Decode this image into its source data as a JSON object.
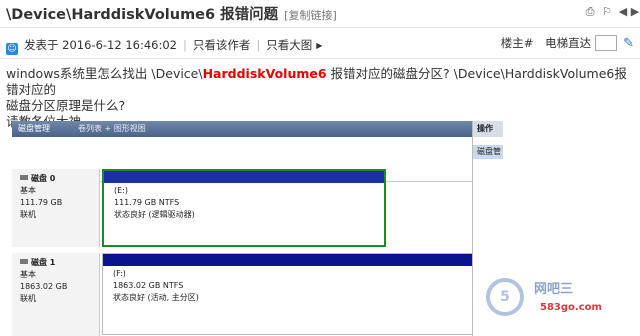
{
  "header": {
    "title": "\\Device\\HarddiskVolume6 报错问题",
    "copy_link": "[复制链接]",
    "icons": [
      "print-icon",
      "favorite-icon",
      "prev-icon",
      "next-icon"
    ]
  },
  "meta": {
    "posted": "发表于 2016-6-12 16:46:02",
    "only_author": "只看该作者",
    "only_big_image": "只看大图",
    "floor": "楼主#",
    "elevator": "电梯直达"
  },
  "post": {
    "line1_a": "windows系统里怎么找出 \\Device\\",
    "line1_red": "HarddiskVolume6",
    "line1_b": " 报错对应的磁盘分区? \\Device\\HarddiskVolume6报错对应的",
    "line2": "磁盘分区原理是什么?",
    "line3": "请教各位大神"
  },
  "screenshot": {
    "header_title": "磁盘管理",
    "header_view": "卷列表 + 图形视图",
    "actions_title": "操作",
    "actions_item": "磁盘管",
    "disks": [
      {
        "name": "磁盘 0",
        "type": "基本",
        "size": "111.79 GB",
        "status": "联机",
        "part_name": "(E:)",
        "part_fs": "111.79 GB NTFS",
        "part_status": "状态良好 (逻辑驱动器)"
      },
      {
        "name": "磁盘 1",
        "type": "基本",
        "size": "1863.02 GB",
        "status": "联机",
        "part_name": "(F:)",
        "part_fs": "1863.02 GB NTFS",
        "part_status": "状态良好 (活动, 主分区)"
      }
    ]
  },
  "watermark": {
    "brand": "网吧三",
    "site": "583go.com",
    "ring": "5"
  }
}
